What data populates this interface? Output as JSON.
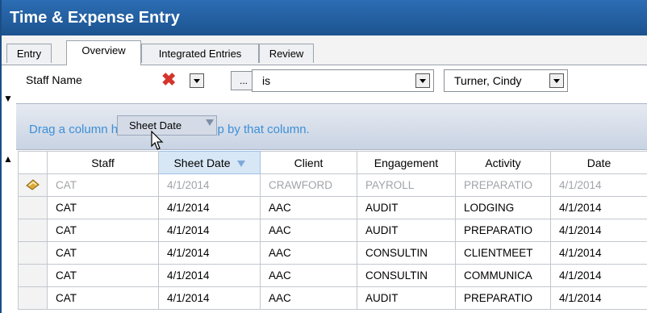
{
  "title": "Time & Expense Entry",
  "tabs": [
    {
      "label": "Entry",
      "active": false
    },
    {
      "label": "Overview",
      "active": true
    },
    {
      "label": "Integrated Entries",
      "active": false
    },
    {
      "label": "Review",
      "active": false
    }
  ],
  "filter": {
    "field": "Staff Name",
    "button_label": "...",
    "operator": "is",
    "value": "Turner, Cindy"
  },
  "group_area": {
    "hint": "Drag a column header here to group by that column.",
    "dragged_header": "Sheet Date"
  },
  "grid": {
    "columns": [
      "Staff",
      "Sheet Date",
      "Client",
      "Engagement",
      "Activity",
      "Date"
    ],
    "sorted_column": "Sheet Date",
    "rows": [
      {
        "staff": "CAT",
        "sheet_date": "4/1/2014",
        "client": "CRAWFORD",
        "engagement": "PAYROLL",
        "activity": "PREPARATIO",
        "date": "4/1/2014",
        "editing": true
      },
      {
        "staff": "CAT",
        "sheet_date": "4/1/2014",
        "client": "AAC",
        "engagement": "AUDIT",
        "activity": "LODGING",
        "date": "4/1/2014",
        "editing": false
      },
      {
        "staff": "CAT",
        "sheet_date": "4/1/2014",
        "client": "AAC",
        "engagement": "AUDIT",
        "activity": "PREPARATIO",
        "date": "4/1/2014",
        "editing": false
      },
      {
        "staff": "CAT",
        "sheet_date": "4/1/2014",
        "client": "AAC",
        "engagement": "CONSULTIN",
        "activity": "CLIENTMEET",
        "date": "4/1/2014",
        "editing": false
      },
      {
        "staff": "CAT",
        "sheet_date": "4/1/2014",
        "client": "AAC",
        "engagement": "CONSULTIN",
        "activity": "COMMUNICA",
        "date": "4/1/2014",
        "editing": false
      },
      {
        "staff": "CAT",
        "sheet_date": "4/1/2014",
        "client": "AAC",
        "engagement": "AUDIT",
        "activity": "PREPARATIO",
        "date": "4/1/2014",
        "editing": false
      }
    ]
  },
  "colors": {
    "title_bg": "#1c538f",
    "accent": "#3d8fd8",
    "delete": "#d4352c"
  }
}
